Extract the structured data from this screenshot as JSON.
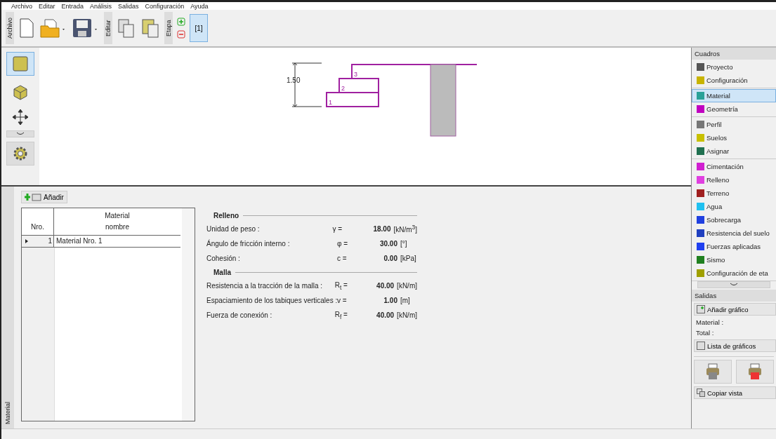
{
  "menu": [
    "Archivo",
    "Editar",
    "Entrada",
    "Análisis",
    "Salidas",
    "Configuración",
    "Ayuda"
  ],
  "toolbar": {
    "groups": [
      {
        "label": "Archivo",
        "kind": "file"
      },
      {
        "label": "Editar",
        "kind": "edit"
      },
      {
        "label": "Etapa",
        "kind": "stage"
      }
    ],
    "stages": [
      {
        "label": "[1]",
        "selected": true
      }
    ]
  },
  "view_tools": [
    {
      "kind": "flat",
      "selected": true
    },
    {
      "kind": "cube",
      "selected": false
    }
  ],
  "drawing": {
    "dimension": "1.50",
    "layers": [
      "1",
      "2",
      "3"
    ]
  },
  "panel": {
    "side_label": "Material",
    "add_button": "Añadir",
    "table": {
      "columns": [
        [
          "",
          "Nro."
        ],
        [
          "Material",
          "nombre"
        ]
      ],
      "rows": [
        {
          "nro": "1",
          "name": "Material Nro. 1",
          "selected": true
        }
      ]
    },
    "sections": [
      {
        "title": "Relleno",
        "rows": [
          {
            "label": "Unidad de peso :",
            "symbol": "γ =",
            "value": "18.00",
            "unit": "[kN/m$^{3}$]"
          },
          {
            "label": "Ángulo de fricción interno :",
            "symbol": "φ =",
            "value": "30.00",
            "unit": "[°]"
          },
          {
            "label": "Cohesión :",
            "symbol": "c =",
            "value": "0.00",
            "unit": "[kPa]"
          }
        ]
      },
      {
        "title": "Malla",
        "rows": [
          {
            "label": "Resistencia a la tracción de la malla :",
            "symbol": "R$_{t}$ =",
            "value": "40.00",
            "unit": "[kN/m]"
          },
          {
            "label": "Espaciamiento de los tabiques verticales :",
            "symbol": "v =",
            "value": "1.00",
            "unit": "[m]"
          },
          {
            "label": "Fuerza de conexión :",
            "symbol": "R$_{f}$ =",
            "value": "40.00",
            "unit": "[kN/m]"
          }
        ]
      }
    ]
  },
  "cuadros": {
    "title": "Cuadros",
    "groups": [
      [
        {
          "label": "Proyecto",
          "color": "#555555",
          "selected": false
        },
        {
          "label": "Configuración",
          "color": "#c8b400",
          "selected": false
        }
      ],
      [
        {
          "label": "Material",
          "color": "#2aa198",
          "selected": true
        },
        {
          "label": "Geometría",
          "color": "#c000c0",
          "selected": false
        }
      ],
      [
        {
          "label": "Perfil",
          "color": "#777777",
          "selected": false
        },
        {
          "label": "Suelos",
          "color": "#c8c000",
          "selected": false
        },
        {
          "label": "Asignar",
          "color": "#207050",
          "selected": false
        }
      ],
      [
        {
          "label": "Cimentación",
          "color": "#d020d0",
          "selected": false
        },
        {
          "label": "Relleno",
          "color": "#e040e0",
          "selected": false
        },
        {
          "label": "Terreno",
          "color": "#a02020",
          "selected": false
        },
        {
          "label": "Agua",
          "color": "#20c0f0",
          "selected": false
        },
        {
          "label": "Sobrecarga",
          "color": "#2040e0",
          "selected": false
        },
        {
          "label": "Resistencia del suelo",
          "color": "#2040c0",
          "selected": false
        },
        {
          "label": "Fuerzas aplicadas",
          "color": "#2040f0",
          "selected": false
        },
        {
          "label": "Sismo",
          "color": "#208020",
          "selected": false
        },
        {
          "label": "Configuración de eta",
          "color": "#a0a000",
          "selected": false
        }
      ]
    ]
  },
  "salidas": {
    "title": "Salidas",
    "add_chart": "Añadir gráfico",
    "counts": [
      "Material :",
      "Total :"
    ],
    "chart_list": "Lista de gráficos",
    "copy_view": "Copiar vista"
  }
}
